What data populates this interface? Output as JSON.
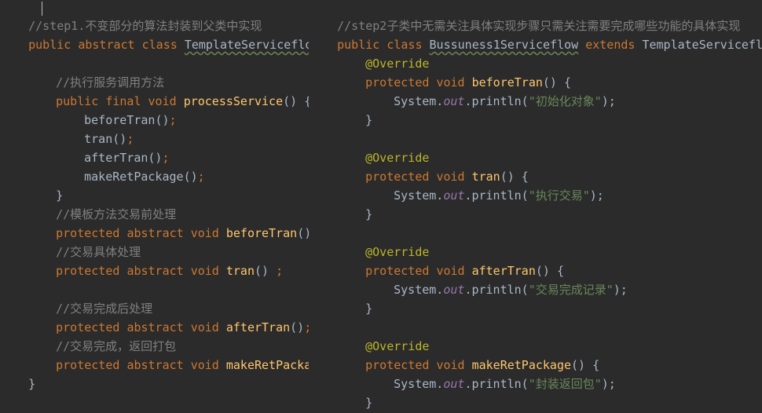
{
  "theme": {
    "background": "#2b2b2b",
    "keyword_color": "#cc7832",
    "method_color": "#ffc66d",
    "comment_color": "#808080",
    "string_color": "#6a8759",
    "annotation_color": "#bbb529",
    "static_field_color": "#9876aa",
    "plain_color": "#a9b7c6"
  },
  "left_code": {
    "header_comment": "//step1.不变部分的算法封装到父类中实现",
    "class_decl": {
      "public": "public",
      "abstract": "abstract",
      "class": "class",
      "name": "TemplateServiceflow",
      "brace": " {"
    },
    "comment_process": "//执行服务调用方法",
    "process_sig": {
      "public": "public",
      "final": "final",
      "void": "void",
      "name": "processService",
      "rest": "() {"
    },
    "calls": [
      {
        "name": "beforeTran",
        "paren": "()",
        "semi": ";"
      },
      {
        "name": "tran",
        "paren": "()",
        "semi": ";"
      },
      {
        "name": "afterTran",
        "paren": "()",
        "semi": ";"
      },
      {
        "name": "makeRetPackage",
        "paren": "()",
        "semi": ";"
      }
    ],
    "method_close": "}",
    "comment_before": "//模板方法交易前处理",
    "abstract_before": {
      "protected": "protected",
      "abstract": "abstract",
      "void": "void",
      "name": "beforeTran",
      "rest": "() ",
      "semi": ";"
    },
    "comment_tran": "//交易具体处理",
    "abstract_tran": {
      "protected": "protected",
      "abstract": "abstract",
      "void": "void",
      "name": "tran",
      "rest": "() ",
      "semi": ";"
    },
    "comment_after": "//交易完成后处理",
    "abstract_after": {
      "protected": "protected",
      "abstract": "abstract",
      "void": "void",
      "name": "afterTran",
      "rest": "()",
      "semi": ";"
    },
    "comment_package": "//交易完成，返回打包",
    "abstract_package": {
      "protected": "protected",
      "abstract": "abstract",
      "void": "void",
      "name": "makeRetPackage",
      "rest": "()"
    },
    "class_close": "}"
  },
  "right_code": {
    "header_comment": "//step2子类中无需关注具体实现步骤只需关注需要完成哪些功能的具体实现",
    "class_decl": {
      "public": "public",
      "class": "class",
      "name": "Bussuness1Serviceflow",
      "extends": "extends",
      "parent": "TemplateServiceflow",
      "brace": " {"
    },
    "methods": [
      {
        "annotation": "@Override",
        "protected": "protected",
        "void": "void",
        "name": "beforeTran",
        "rest": "() {",
        "system": "System.",
        "out": "out",
        "println": ".println(",
        "text": "\"初始化对象\"",
        "end": ");",
        "close": "}"
      },
      {
        "annotation": "@Override",
        "protected": "protected",
        "void": "void",
        "name": "tran",
        "rest": "() {",
        "system": "System.",
        "out": "out",
        "println": ".println(",
        "text": "\"执行交易\"",
        "end": ");",
        "close": "}"
      },
      {
        "annotation": "@Override",
        "protected": "protected",
        "void": "void",
        "name": "afterTran",
        "rest": "() {",
        "system": "System.",
        "out": "out",
        "println": ".println(",
        "text": "\"交易完成记录\"",
        "end": ");",
        "close": "}"
      },
      {
        "annotation": "@Override",
        "protected": "protected",
        "void": "void",
        "name": "makeRetPackage",
        "rest": "() {",
        "system": "System.",
        "out": "out",
        "println": ".println(",
        "text": "\"封装返回包\"",
        "end": ");",
        "close": "}"
      }
    ],
    "class_close": "}"
  }
}
